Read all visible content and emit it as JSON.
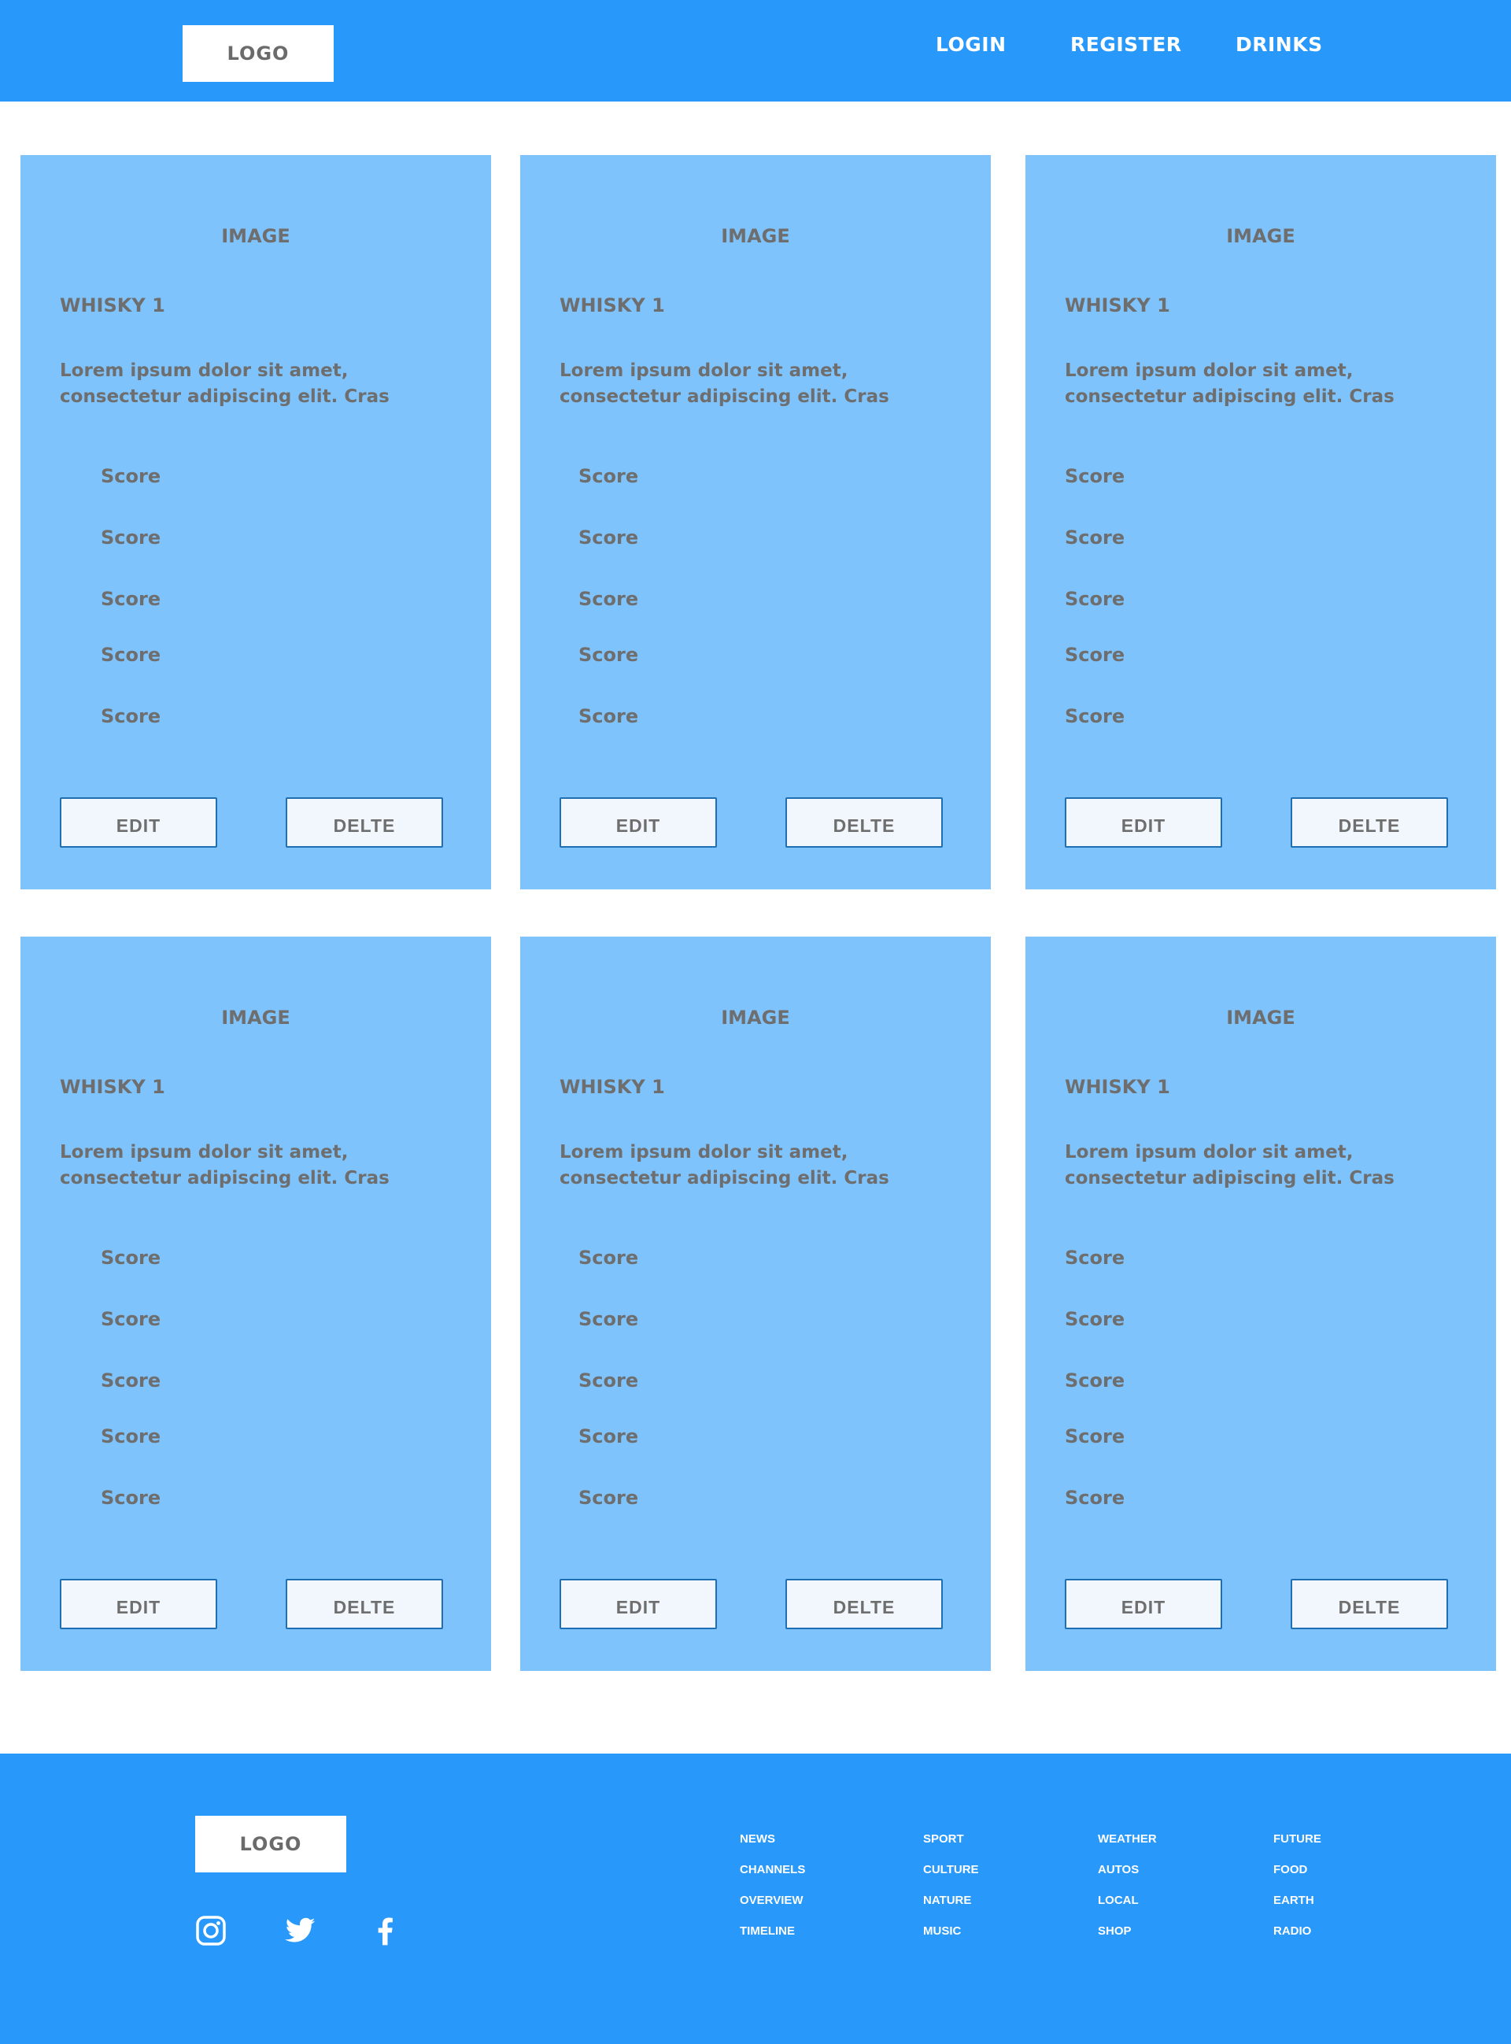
{
  "header": {
    "logo": "LOGO",
    "nav": [
      "LOGIN",
      "REGISTER",
      "DRINKS"
    ]
  },
  "cards": [
    {
      "image": "IMAGE",
      "title": "WHISKY 1",
      "description": "Lorem ipsum dolor sit amet, consectetur adipiscing elit. Cras",
      "scores": [
        "Score",
        "Score",
        "Score",
        "Score",
        "Score"
      ],
      "edit": "EDIT",
      "delete": "DELTE"
    },
    {
      "image": "IMAGE",
      "title": "WHISKY 1",
      "description": "Lorem ipsum dolor sit amet, consectetur adipiscing elit. Cras",
      "scores": [
        "Score",
        "Score",
        "Score",
        "Score",
        "Score"
      ],
      "edit": "EDIT",
      "delete": "DELTE"
    },
    {
      "image": "IMAGE",
      "title": "WHISKY 1",
      "description": "Lorem ipsum dolor sit amet, consectetur adipiscing elit. Cras",
      "scores": [
        "Score",
        "Score",
        "Score",
        "Score",
        "Score"
      ],
      "edit": "EDIT",
      "delete": "DELTE"
    },
    {
      "image": "IMAGE",
      "title": "WHISKY 1",
      "description": "Lorem ipsum dolor sit amet, consectetur adipiscing elit. Cras",
      "scores": [
        "Score",
        "Score",
        "Score",
        "Score",
        "Score"
      ],
      "edit": "EDIT",
      "delete": "DELTE"
    },
    {
      "image": "IMAGE",
      "title": "WHISKY 1",
      "description": "Lorem ipsum dolor sit amet, consectetur adipiscing elit. Cras",
      "scores": [
        "Score",
        "Score",
        "Score",
        "Score",
        "Score"
      ],
      "edit": "EDIT",
      "delete": "DELTE"
    },
    {
      "image": "IMAGE",
      "title": "WHISKY 1",
      "description": "Lorem ipsum dolor sit amet, consectetur adipiscing elit. Cras",
      "scores": [
        "Score",
        "Score",
        "Score",
        "Score",
        "Score"
      ],
      "edit": "EDIT",
      "delete": "DELTE"
    }
  ],
  "footer": {
    "logo": "LOGO",
    "social": [
      "instagram-icon",
      "twitter-icon",
      "facebook-icon"
    ],
    "link_columns": [
      [
        "NEWS",
        "CHANNELS",
        "OVERVIEW",
        "TIMELINE"
      ],
      [
        "SPORT",
        "CULTURE",
        "NATURE",
        "MUSIC"
      ],
      [
        "WEATHER",
        "AUTOS",
        "LOCAL",
        "SHOP"
      ],
      [
        "FUTURE",
        "FOOD",
        "EARTH",
        "RADIO"
      ]
    ]
  },
  "colors": {
    "primary": "#2898fa",
    "card": "#7fc3fc",
    "text": "#6e6e6e",
    "button_bg": "#f1f7fd",
    "button_border": "#1e6fb3"
  }
}
